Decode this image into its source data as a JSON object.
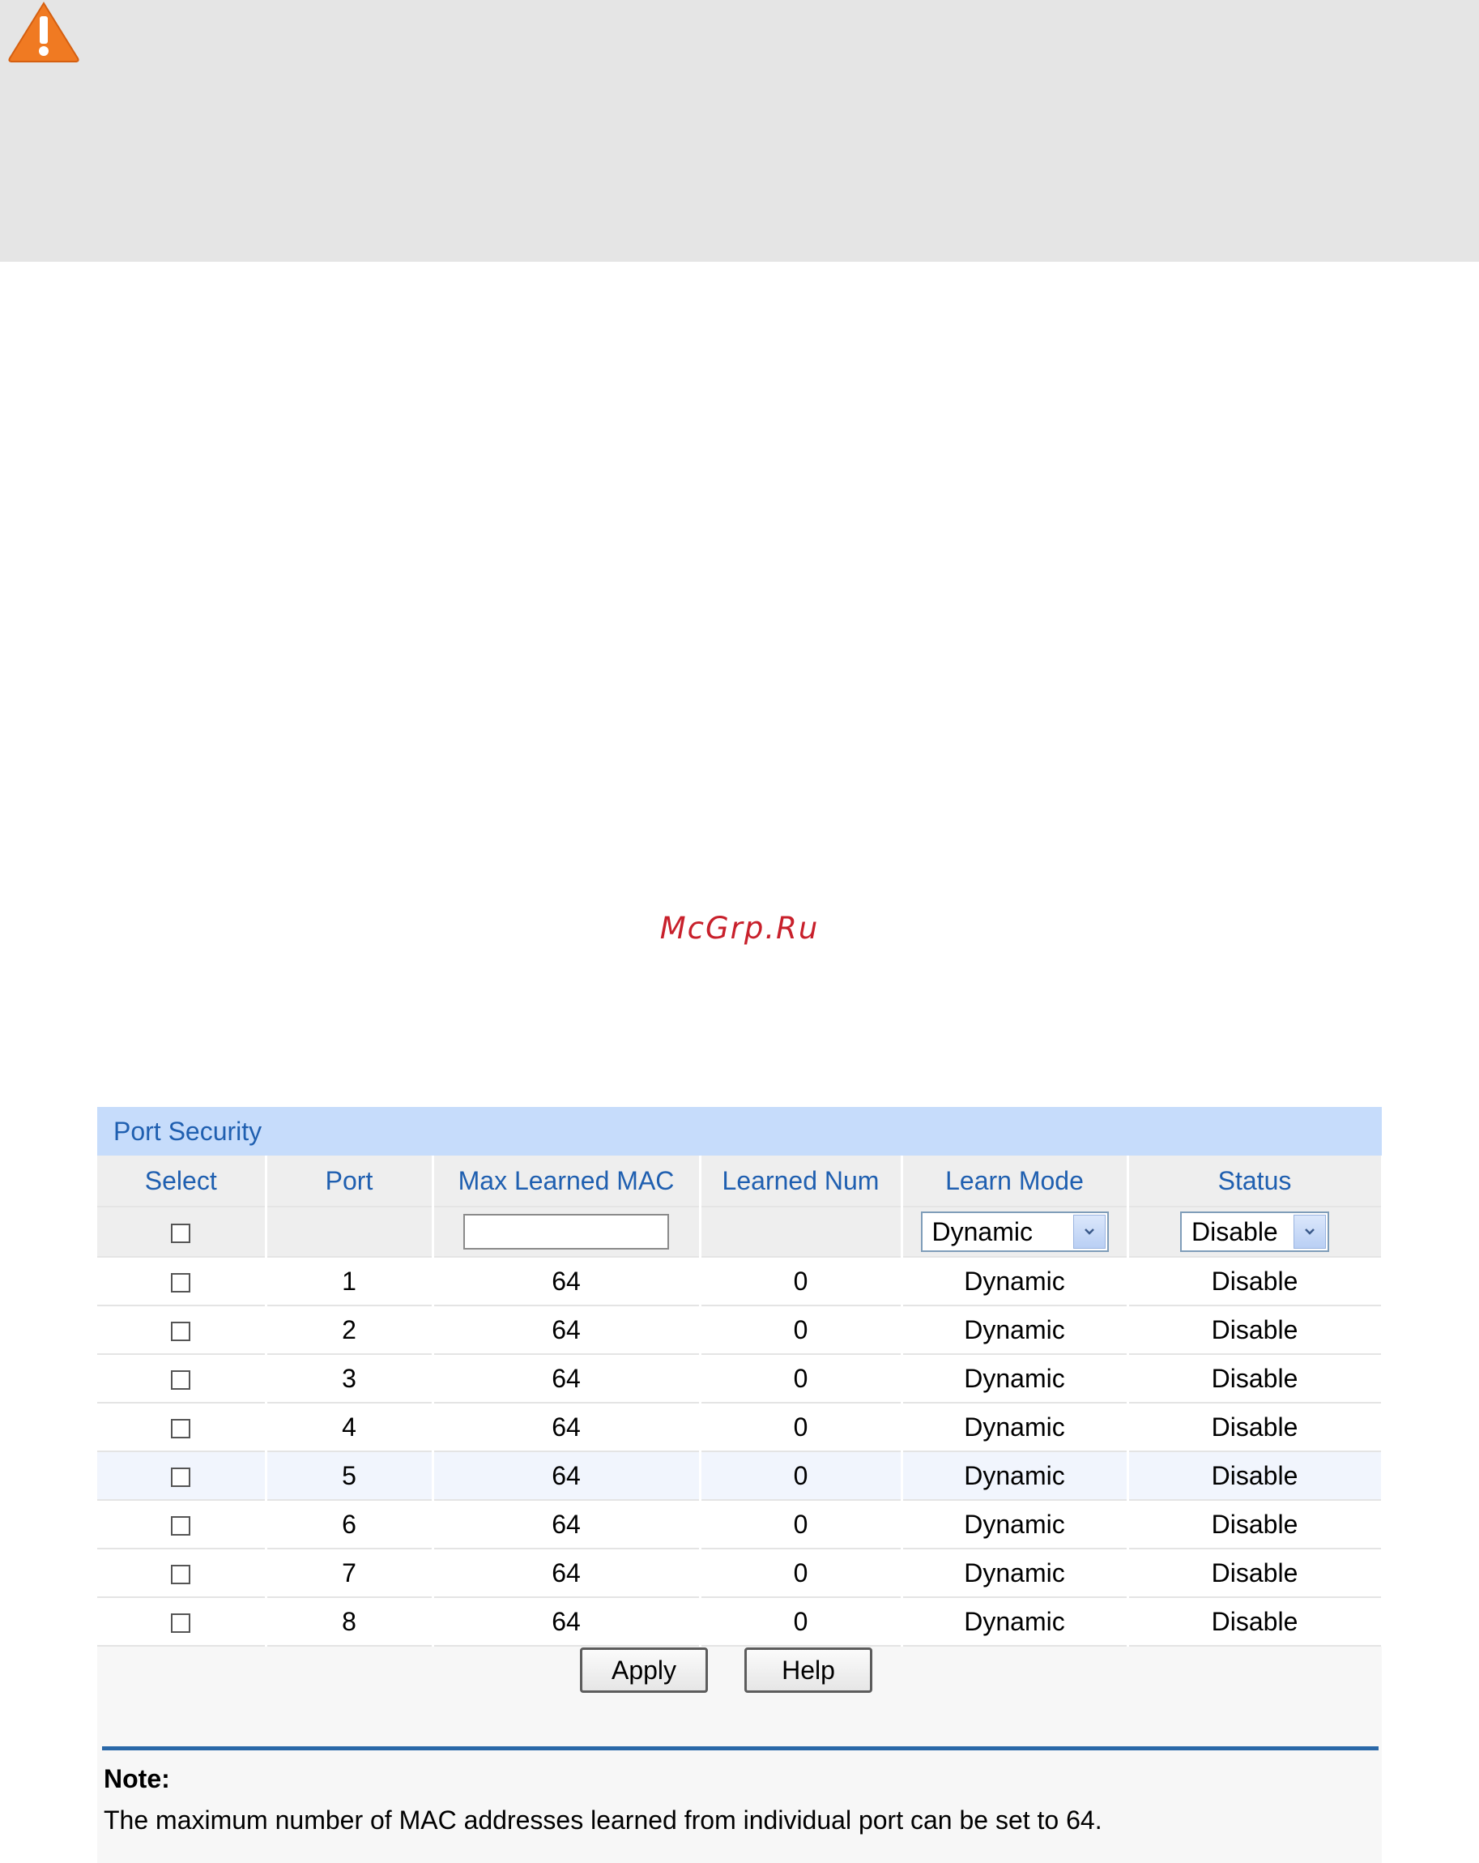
{
  "watermark": "McGrp.Ru",
  "colors": {
    "accent": "#1f5fb0",
    "title_bar": "#c6dcfb",
    "warning": "#f07a22"
  },
  "icons": {
    "warning": "warning-triangle-icon",
    "dropdown": "chevron-down-icon"
  },
  "panel": {
    "title": "Port Security",
    "columns": [
      "Select",
      "Port",
      "Max Learned MAC",
      "Learned Num",
      "Learn Mode",
      "Status"
    ],
    "filter": {
      "max_mac_value": "",
      "learn_mode": "Dynamic",
      "status": "Disable"
    },
    "rows": [
      {
        "port": "1",
        "max": "64",
        "learned": "0",
        "mode": "Dynamic",
        "status": "Disable"
      },
      {
        "port": "2",
        "max": "64",
        "learned": "0",
        "mode": "Dynamic",
        "status": "Disable"
      },
      {
        "port": "3",
        "max": "64",
        "learned": "0",
        "mode": "Dynamic",
        "status": "Disable"
      },
      {
        "port": "4",
        "max": "64",
        "learned": "0",
        "mode": "Dynamic",
        "status": "Disable"
      },
      {
        "port": "5",
        "max": "64",
        "learned": "0",
        "mode": "Dynamic",
        "status": "Disable"
      },
      {
        "port": "6",
        "max": "64",
        "learned": "0",
        "mode": "Dynamic",
        "status": "Disable"
      },
      {
        "port": "7",
        "max": "64",
        "learned": "0",
        "mode": "Dynamic",
        "status": "Disable"
      },
      {
        "port": "8",
        "max": "64",
        "learned": "0",
        "mode": "Dynamic",
        "status": "Disable"
      }
    ],
    "apply_label": "Apply",
    "help_label": "Help"
  },
  "note": {
    "title": "Note:",
    "text": "The maximum number of MAC addresses learned from individual port can be set to 64."
  }
}
